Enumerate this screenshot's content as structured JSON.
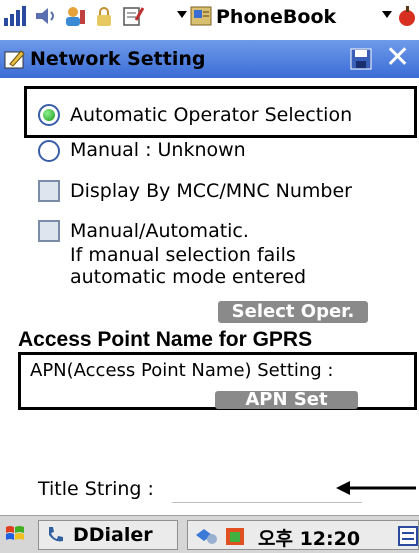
{
  "topbar": {
    "app_name": "PhoneBook"
  },
  "window": {
    "title": "Network Setting"
  },
  "operator": {
    "automatic_label": "Automatic Operator Selection",
    "automatic_selected": true,
    "manual_label": "Manual :  Unknown",
    "manual_selected": false
  },
  "options": {
    "mcc_label": "Display By MCC/MNC Number",
    "mcc_checked": false,
    "manual_auto_line1": "Manual/Automatic.",
    "manual_auto_line2": "If manual selection fails",
    "manual_auto_line3": "automatic mode entered",
    "manual_auto_checked": false
  },
  "buttons": {
    "select_operator": "Select Oper.",
    "apn_set": "APN Set"
  },
  "gprs": {
    "heading": "Access Point Name for GPRS",
    "apn_label": "APN(Access Point Name) Setting :"
  },
  "title_string": {
    "label": "Title String :",
    "value": ""
  },
  "taskbar": {
    "app_label": "DDialer",
    "clock": "오후 12:20"
  },
  "colors": {
    "titlebar": "#3a6cd6",
    "button_gray": "#8a8a8a",
    "radio_selected": "#1a9a1a"
  }
}
